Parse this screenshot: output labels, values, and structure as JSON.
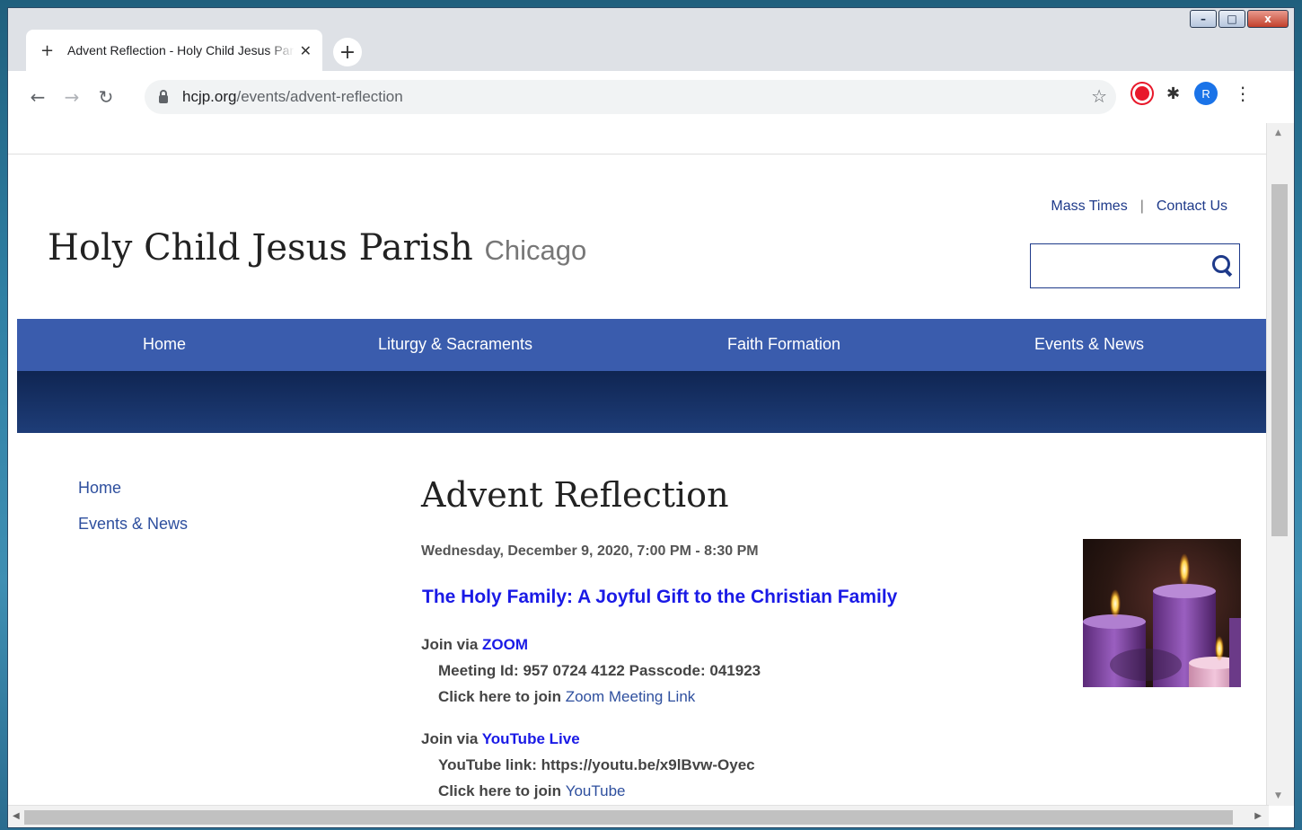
{
  "browser": {
    "tab_title": "Advent Reflection - Holy Child Jesus Parish",
    "new_tab_label": "+",
    "address_host": "hcjp.org",
    "address_path": "/events/advent-reflection",
    "avatar_initial": "R",
    "caption_minimize": "–",
    "caption_maximize": "□",
    "caption_close": "x"
  },
  "site": {
    "name": "Holy Child Jesus Parish",
    "city": "Chicago",
    "top_links": [
      "Mass Times",
      "Contact Us"
    ],
    "search_placeholder": "",
    "nav": [
      "Home",
      "Liturgy & Sacraments",
      "Faith Formation",
      "Events & News"
    ],
    "breadcrumb": [
      "Home",
      "Events & News"
    ]
  },
  "event": {
    "title": "Advent Reflection",
    "datetime": "Wednesday, December 9, 2020, 7:00 PM - 8:30 PM",
    "subtitle": "The Holy Family:  A Joyful Gift to the Christian Family",
    "zoom_prefix": "Join via ",
    "zoom_label": "ZOOM",
    "zoom_meeting": "Meeting Id:  957 0724 4122  Passcode: 041923",
    "zoom_click_prefix": "Click here to join ",
    "zoom_link": "Zoom Meeting Link",
    "youtube_prefix": "Join via ",
    "youtube_label": "YouTube Live",
    "youtube_url_line": "YouTube link: https://youtu.be/x9lBvw-Oyec",
    "youtube_click_prefix": "Click here to join ",
    "youtube_link": "YouTube"
  },
  "colors": {
    "nav_bg": "#3a5cad",
    "link": "#2e4f9e",
    "accent_blue": "#1a1ae6",
    "avatar": "#1a73e8",
    "record": "#e8182a"
  },
  "icons": [
    "back-arrow-icon",
    "forward-arrow-icon",
    "reload-icon",
    "lock-icon",
    "star-icon",
    "record-icon",
    "puzzle-icon",
    "kebab-menu-icon",
    "search-icon",
    "close-icon",
    "plus-icon"
  ]
}
